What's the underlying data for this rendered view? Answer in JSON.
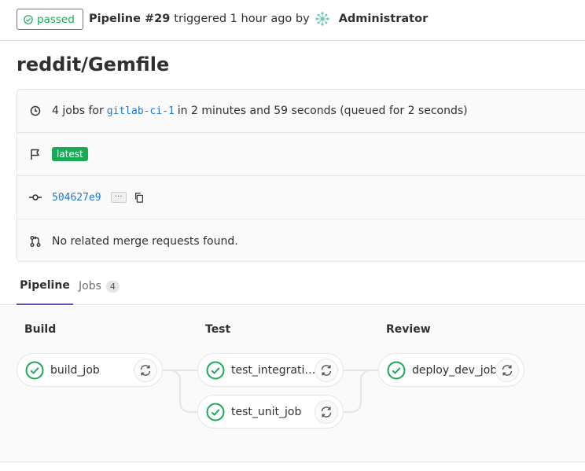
{
  "header": {
    "status": "passed",
    "pipeline_label": "Pipeline #29",
    "triggered_text": "triggered 1 hour ago by",
    "user": "Administrator"
  },
  "title": "reddit/Gemfile",
  "info": {
    "jobs_count_text": "4 jobs for",
    "branch": "gitlab-ci-1",
    "duration_text": "in 2 minutes and 59 seconds (queued for 2 seconds)",
    "badge": "latest",
    "commit_sha": "504627e9",
    "ellipsis": "···",
    "mr_text": "No related merge requests found."
  },
  "tabs": {
    "pipeline": "Pipeline",
    "jobs": "Jobs",
    "jobs_count": "4"
  },
  "stages": [
    {
      "name": "Build",
      "jobs": [
        {
          "name": "build_job",
          "status": "success"
        }
      ]
    },
    {
      "name": "Test",
      "jobs": [
        {
          "name": "test_integratio...",
          "status": "success"
        },
        {
          "name": "test_unit_job",
          "status": "success"
        }
      ]
    },
    {
      "name": "Review",
      "jobs": [
        {
          "name": "deploy_dev_job",
          "status": "success"
        }
      ]
    }
  ],
  "colors": {
    "success": "#1aaa55",
    "link": "#1f78d1",
    "active_tab": "#6b4fbb"
  },
  "icons": {
    "clock": "clock-icon",
    "flag": "flag-icon",
    "commit": "commit-icon",
    "merge_request": "merge-request-icon",
    "copy": "copy-icon",
    "retry": "retry-icon",
    "status_success": "status-success-icon"
  }
}
